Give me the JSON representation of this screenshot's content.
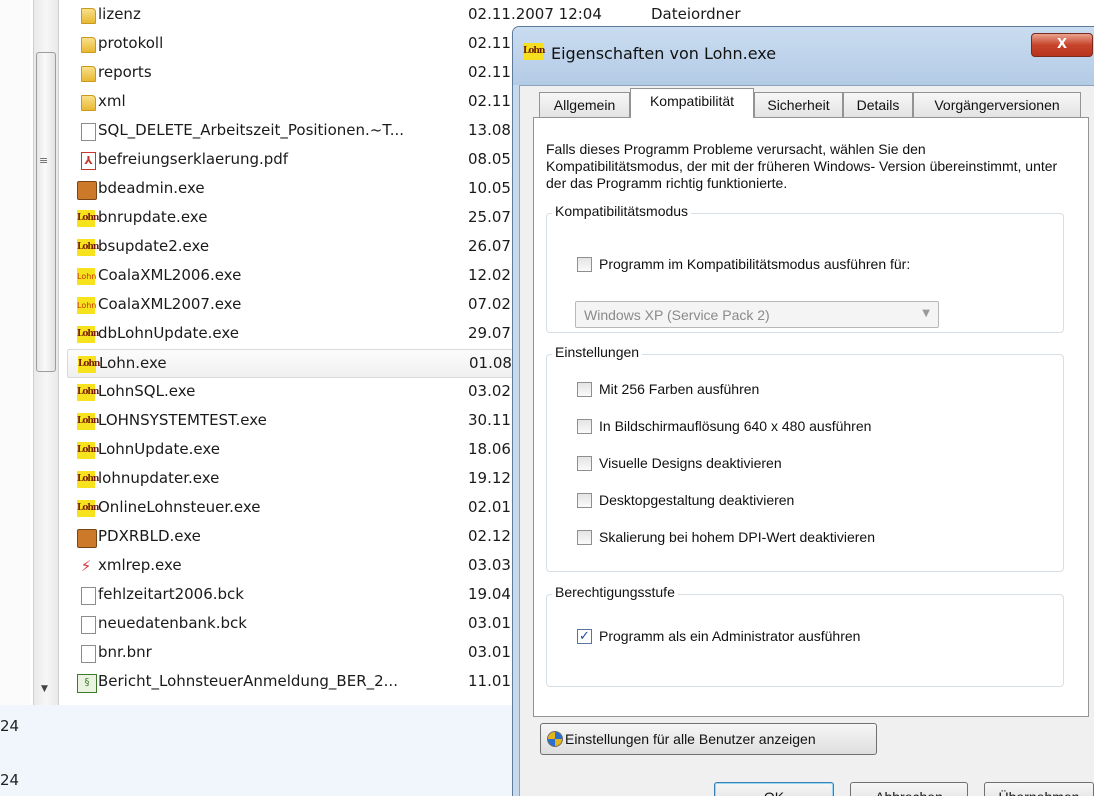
{
  "explorer": {
    "rows": [
      {
        "name": "lizenz",
        "date": "02.11.2007 12:04",
        "type": "Dateiordner",
        "icon": "folder-icon"
      },
      {
        "name": "protokoll",
        "date": "02.11",
        "icon": "folder-icon"
      },
      {
        "name": "reports",
        "date": "02.11",
        "icon": "folder-icon"
      },
      {
        "name": "xml",
        "date": "02.11",
        "icon": "folder-icon"
      },
      {
        "name": "SQL_DELETE_Arbeitszeit_Positionen.~T...",
        "date": "13.08",
        "icon": "document-icon"
      },
      {
        "name": "befreiungserklaerung.pdf",
        "date": "08.05",
        "icon": "pdf-icon"
      },
      {
        "name": "bdeadmin.exe",
        "date": "10.05",
        "icon": "app-icon"
      },
      {
        "name": "bnrupdate.exe",
        "date": "25.07",
        "icon": "lohn-icon"
      },
      {
        "name": "bsupdate2.exe",
        "date": "26.07",
        "icon": "lohn-icon"
      },
      {
        "name": "CoalaXML2006.exe",
        "date": "12.02",
        "icon": "lohn-small-icon"
      },
      {
        "name": "CoalaXML2007.exe",
        "date": "07.02",
        "icon": "lohn-small-icon"
      },
      {
        "name": "dbLohnUpdate.exe",
        "date": "29.07",
        "icon": "lohn-icon"
      },
      {
        "name": "Lohn.exe",
        "date": "01.08",
        "icon": "lohn-icon",
        "selected": true
      },
      {
        "name": "LohnSQL.exe",
        "date": "03.02",
        "icon": "lohn-icon"
      },
      {
        "name": "LOHNSYSTEMTEST.exe",
        "date": "30.11",
        "icon": "lohn-icon"
      },
      {
        "name": "LohnUpdate.exe",
        "date": "18.06",
        "icon": "lohn-icon"
      },
      {
        "name": "lohnupdater.exe",
        "date": "19.12",
        "icon": "lohn-icon"
      },
      {
        "name": "OnlineLohnsteuer.exe",
        "date": "02.01",
        "icon": "lohn-icon"
      },
      {
        "name": "PDXRBLD.exe",
        "date": "02.12",
        "icon": "app-icon"
      },
      {
        "name": "xmlrep.exe",
        "date": "03.03",
        "icon": "graph-icon"
      },
      {
        "name": "fehlzeitart2006.bck",
        "date": "19.04",
        "icon": "document-icon"
      },
      {
        "name": "neuedatenbank.bck",
        "date": "03.01",
        "icon": "document-icon"
      },
      {
        "name": "bnr.bnr",
        "date": "03.01",
        "icon": "document-icon"
      },
      {
        "name": "Bericht_LohnsteuerAnmeldung_BER_2...",
        "date": "11.01",
        "icon": "report-icon"
      }
    ],
    "bottom_fragments": [
      "24",
      "24"
    ],
    "scroll_grip": "≡"
  },
  "dialog": {
    "title": "Eigenschaften von Lohn.exe",
    "title_icon_text": "Lohn",
    "close_glyph": "X",
    "tabs": [
      "Allgemein",
      "Kompatibilität",
      "Sicherheit",
      "Details",
      "Vorgängerversionen"
    ],
    "active_tab": "Kompatibilität",
    "intro": "Falls dieses Programm Probleme verursacht, wählen Sie den Kompatibilitätsmodus, der mit der früheren Windows- Version übereinstimmt, unter der das Programm richtig funktionierte.",
    "compat_group": {
      "label": "Kompatibilitätsmodus",
      "checkbox_label": "Programm im Kompatibilitätsmodus ausführen für:",
      "checked": false,
      "select_value": "Windows XP (Service Pack 2)"
    },
    "settings_group": {
      "label": "Einstellungen",
      "options": [
        {
          "label": "Mit 256 Farben ausführen",
          "checked": false
        },
        {
          "label": "In Bildschirmauflösung 640 x 480 ausführen",
          "checked": false
        },
        {
          "label": "Visuelle Designs deaktivieren",
          "checked": false
        },
        {
          "label": "Desktopgestaltung deaktivieren",
          "checked": false
        },
        {
          "label": "Skalierung bei hohem DPI-Wert deaktivieren",
          "checked": false
        }
      ]
    },
    "privilege_group": {
      "label": "Berechtigungsstufe",
      "checkbox_label": "Programm als ein Administrator ausführen",
      "checked": true
    },
    "all_users_button": "Einstellungen für alle Benutzer anzeigen",
    "buttons": {
      "ok": "OK",
      "cancel": "Abbrechen",
      "apply": "Übernehmen"
    },
    "check_glyph": "✓"
  }
}
